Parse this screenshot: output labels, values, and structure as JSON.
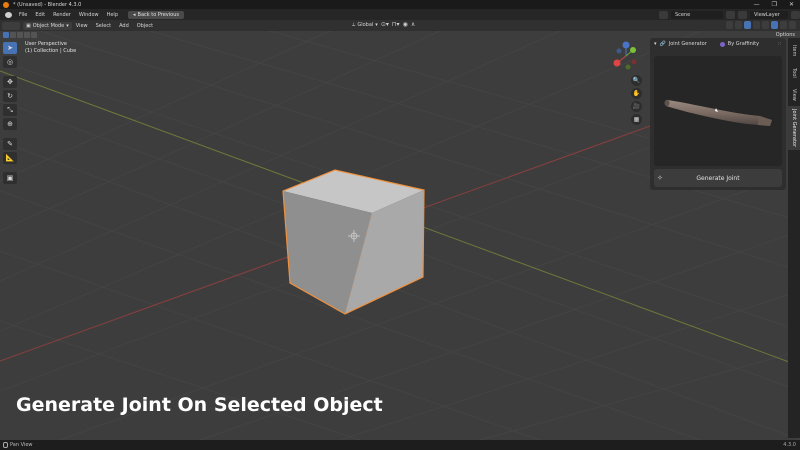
{
  "window": {
    "title": "* (Unsaved) - Blender 4.3.0",
    "controls": [
      "—",
      "❐",
      "✕"
    ]
  },
  "menubar": {
    "items": [
      "File",
      "Edit",
      "Render",
      "Window",
      "Help"
    ],
    "back_button": "Back to Previous",
    "scene": "Scene",
    "view_layer": "ViewLayer"
  },
  "viewport_header": {
    "mode": "Object Mode",
    "menus": [
      "View",
      "Select",
      "Add",
      "Object"
    ],
    "orientation": "Global",
    "options": "Options"
  },
  "viewport": {
    "perspective": "User Perspective",
    "collection": "(1) Collection | Cube"
  },
  "toolbar": {
    "tools": [
      {
        "icon": "select-cursor-icon",
        "glyph": "➤",
        "active": true
      },
      {
        "icon": "cursor-icon",
        "glyph": "◎",
        "active": false
      },
      {
        "icon": "move-icon",
        "glyph": "✥",
        "active": false
      },
      {
        "icon": "rotate-icon",
        "glyph": "↻",
        "active": false
      },
      {
        "icon": "scale-icon",
        "glyph": "⤡",
        "active": false
      },
      {
        "icon": "transform-icon",
        "glyph": "⊕",
        "active": false
      },
      {
        "icon": "annotate-icon",
        "glyph": "✎",
        "active": false
      },
      {
        "icon": "measure-icon",
        "glyph": "📐",
        "active": false
      },
      {
        "icon": "add-cube-icon",
        "glyph": "▣",
        "active": false
      }
    ]
  },
  "nav_gizmo": {
    "buttons": [
      {
        "name": "zoom-icon",
        "glyph": "🔍"
      },
      {
        "name": "pan-hand-icon",
        "glyph": "✋"
      },
      {
        "name": "camera-view-icon",
        "glyph": "🎥"
      },
      {
        "name": "ortho-grid-icon",
        "glyph": "▦"
      }
    ]
  },
  "npanel": {
    "panel_title": "Joint Generator",
    "author": "By Graffinity",
    "generate_label": "Generate Joint"
  },
  "side_tabs": [
    "Item",
    "Tool",
    "View",
    "Joint Generator"
  ],
  "caption": "Generate Joint On Selected Object",
  "statusbar": {
    "hint": "Pan View",
    "version": "4.3.0"
  },
  "colors": {
    "accent": "#4772b3",
    "selection_outline": "#f0903c",
    "viewport_bg": "#3d3d3d"
  }
}
